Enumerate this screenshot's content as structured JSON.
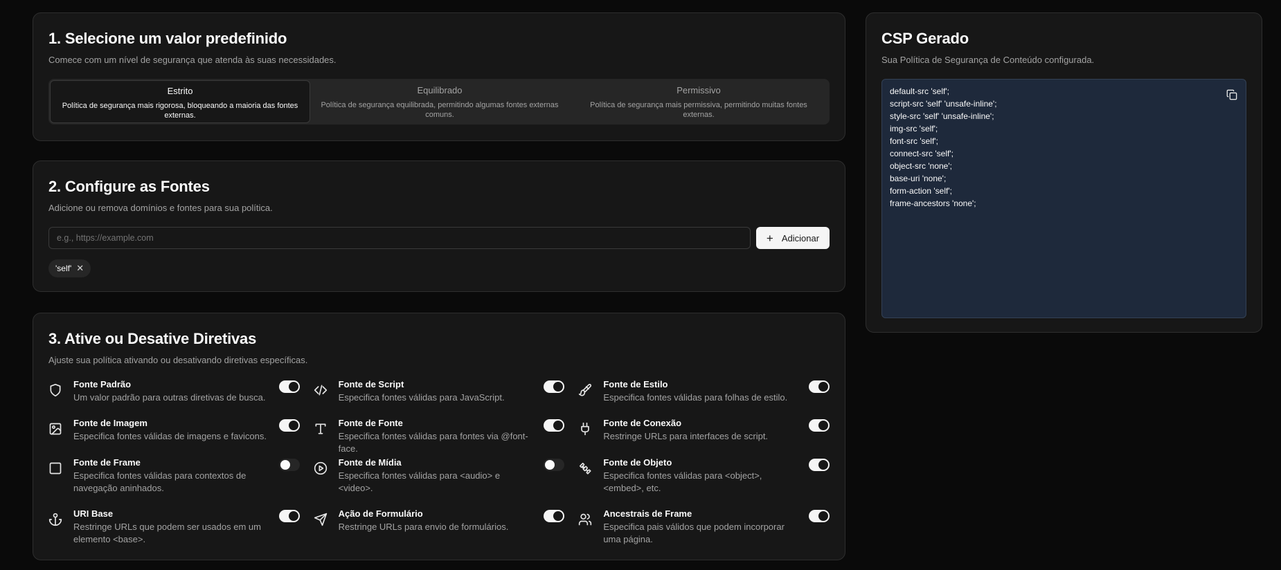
{
  "presets": {
    "title": "1. Selecione um valor predefinido",
    "description": "Comece com um nível de segurança que atenda às suas necessidades.",
    "tabs": [
      {
        "label": "Estrito",
        "description": "Política de segurança mais rigorosa, bloqueando a maioria das fontes externas.",
        "active": true
      },
      {
        "label": "Equilibrado",
        "description": "Política de segurança equilibrada, permitindo algumas fontes externas comuns.",
        "active": false
      },
      {
        "label": "Permissivo",
        "description": "Política de segurança mais permissiva, permitindo muitas fontes externas.",
        "active": false
      }
    ]
  },
  "sources": {
    "title": "2. Configure as Fontes",
    "description": "Adicione ou remova domínios e fontes para sua política.",
    "input_placeholder": "e.g., https://example.com",
    "input_value": "",
    "add_button_label": "Adicionar",
    "chips": [
      "'self'"
    ]
  },
  "directives": {
    "title": "3. Ative ou Desative Diretivas",
    "description": "Ajuste sua política ativando ou desativando diretivas específicas.",
    "items": [
      {
        "name": "Fonte Padrão",
        "description": "Um valor padrão para outras diretivas de busca.",
        "icon": "shield-icon",
        "enabled": true
      },
      {
        "name": "Fonte de Script",
        "description": "Especifica fontes válidas para JavaScript.",
        "icon": "code-icon",
        "enabled": true
      },
      {
        "name": "Fonte de Estilo",
        "description": "Especifica fontes válidas para folhas de estilo.",
        "icon": "paintbrush-icon",
        "enabled": true
      },
      {
        "name": "Fonte de Imagem",
        "description": "Especifica fontes válidas de imagens e favicons.",
        "icon": "image-icon",
        "enabled": true
      },
      {
        "name": "Fonte de Fonte",
        "description": "Especifica fontes válidas para fontes via @font-face.",
        "icon": "type-icon",
        "enabled": true
      },
      {
        "name": "Fonte de Conexão",
        "description": "Restringe URLs para interfaces de script.",
        "icon": "plug-icon",
        "enabled": true
      },
      {
        "name": "Fonte de Frame",
        "description": "Especifica fontes válidas para contextos de navegação aninhados.",
        "icon": "square-icon",
        "enabled": false
      },
      {
        "name": "Fonte de Mídia",
        "description": "Especifica fontes válidas para <audio> e <video>.",
        "icon": "play-circle-icon",
        "enabled": false
      },
      {
        "name": "Fonte de Objeto",
        "description": "Especifica fontes válidas para <object>, <embed>, etc.",
        "icon": "puzzle-icon",
        "enabled": true
      },
      {
        "name": "URI Base",
        "description": "Restringe URLs que podem ser usados em um elemento <base>.",
        "icon": "anchor-icon",
        "enabled": true
      },
      {
        "name": "Ação de Formulário",
        "description": "Restringe URLs para envio de formulários.",
        "icon": "send-icon",
        "enabled": true
      },
      {
        "name": "Ancestrais de Frame",
        "description": "Especifica pais válidos que podem incorporar uma página.",
        "icon": "users-icon",
        "enabled": true
      }
    ]
  },
  "output": {
    "title": "CSP Gerado",
    "description": "Sua Política de Segurança de Conteúdo configurada.",
    "csp_lines": [
      "default-src 'self';",
      "script-src 'self' 'unsafe-inline';",
      "style-src 'self' 'unsafe-inline';",
      "img-src 'self';",
      "font-src 'self';",
      "connect-src 'self';",
      "object-src 'none';",
      "base-uri 'none';",
      "form-action 'self';",
      "frame-ancestors 'none';"
    ],
    "copy_icon": "copy-icon"
  }
}
